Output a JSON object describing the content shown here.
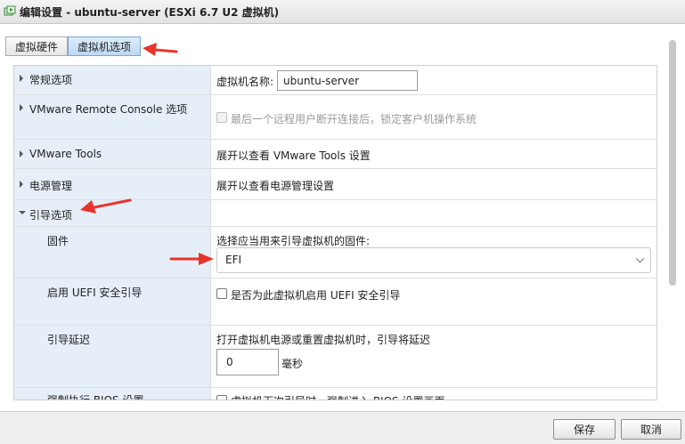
{
  "window": {
    "title": "编辑设置 - ubuntu-server (ESXi 6.7 U2 虚拟机)",
    "icon": "vm-icon"
  },
  "tabs": [
    {
      "label": "虚拟硬件",
      "active": false
    },
    {
      "label": "虚拟机选项",
      "active": true
    }
  ],
  "sections": {
    "general": {
      "label": "常规选项",
      "vm_name_label": "虚拟机名称:",
      "vm_name_value": "ubuntu-server"
    },
    "vmrc": {
      "label": "VMware Remote Console 选项",
      "lock_option": "最后一个远程用户断开连接后，锁定客户机操作系统"
    },
    "tools": {
      "label": "VMware Tools",
      "hint": "展开以查看 VMware Tools 设置"
    },
    "power": {
      "label": "电源管理",
      "hint": "展开以查看电源管理设置"
    },
    "boot": {
      "label": "引导选项",
      "firmware": {
        "label": "固件",
        "prompt": "选择应当用来引导虚拟机的固件:",
        "selected": "EFI"
      },
      "secure_boot": {
        "label": "启用 UEFI 安全引导",
        "option": "是否为此虚拟机启用 UEFI 安全引导"
      },
      "boot_delay": {
        "label": "引导延迟",
        "prompt": "打开虚拟机电源或重置虚拟机时，引导将延迟",
        "value": "0",
        "unit": "毫秒"
      },
      "force_bios": {
        "label": "强制执行 BIOS 设置",
        "option": "虚拟机下次引导时，强制进入 BIOS 设置画面"
      }
    }
  },
  "footer": {
    "save_label": "保存",
    "cancel_label": "取消"
  },
  "colors": {
    "annotation_arrow": "#e8352a",
    "left_column_bg": "#e6eef8",
    "active_tab_bg": "#bcd9f4"
  }
}
